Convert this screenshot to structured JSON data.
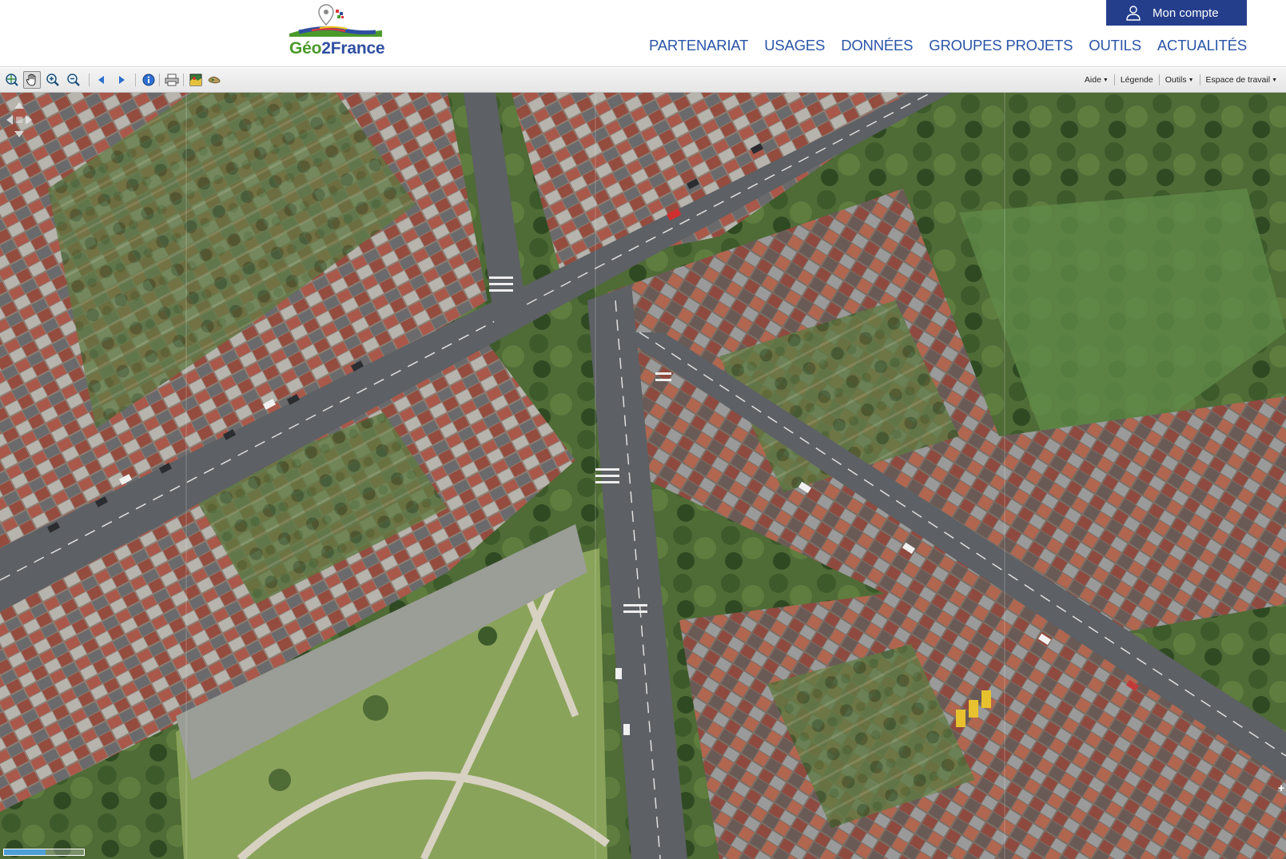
{
  "header": {
    "logo": {
      "text_geo": "Géo",
      "text_2": "2",
      "text_france": "France",
      "icon": "geo2france-logo"
    },
    "account_label": "Mon compte",
    "nav": [
      {
        "label": "PARTENARIAT"
      },
      {
        "label": "USAGES"
      },
      {
        "label": "DONNÉES"
      },
      {
        "label": "GROUPES PROJETS"
      },
      {
        "label": "OUTILS"
      },
      {
        "label": "ACTUALITÉS"
      }
    ],
    "colors": {
      "brand_blue": "#253e8c",
      "nav_blue": "#2a55a8",
      "logo_green": "#4a9a2a"
    }
  },
  "toolbar": {
    "tools": [
      {
        "icon": "zoom-to-extent-icon"
      },
      {
        "icon": "pan-hand-icon",
        "active": true
      },
      {
        "icon": "zoom-in-icon"
      },
      {
        "icon": "zoom-out-icon"
      },
      {
        "icon": "previous-view-icon"
      },
      {
        "icon": "next-view-icon"
      },
      {
        "icon": "info-icon"
      },
      {
        "icon": "print-icon"
      },
      {
        "icon": "map-layer-icon"
      },
      {
        "icon": "tool-extra-icon"
      }
    ],
    "menus": [
      {
        "label": "Aide",
        "has_dropdown": true
      },
      {
        "label": "Légende",
        "has_dropdown": false
      },
      {
        "label": "Outils",
        "has_dropdown": true
      },
      {
        "label": "Espace de travail",
        "has_dropdown": true
      }
    ]
  },
  "map": {
    "type": "aerial-orthophoto",
    "controls": [
      "pan-up-icon",
      "pan-left-icon",
      "pan-right-icon",
      "pan-down-icon"
    ],
    "scalebar": {
      "fill_fraction": 0.52
    }
  }
}
